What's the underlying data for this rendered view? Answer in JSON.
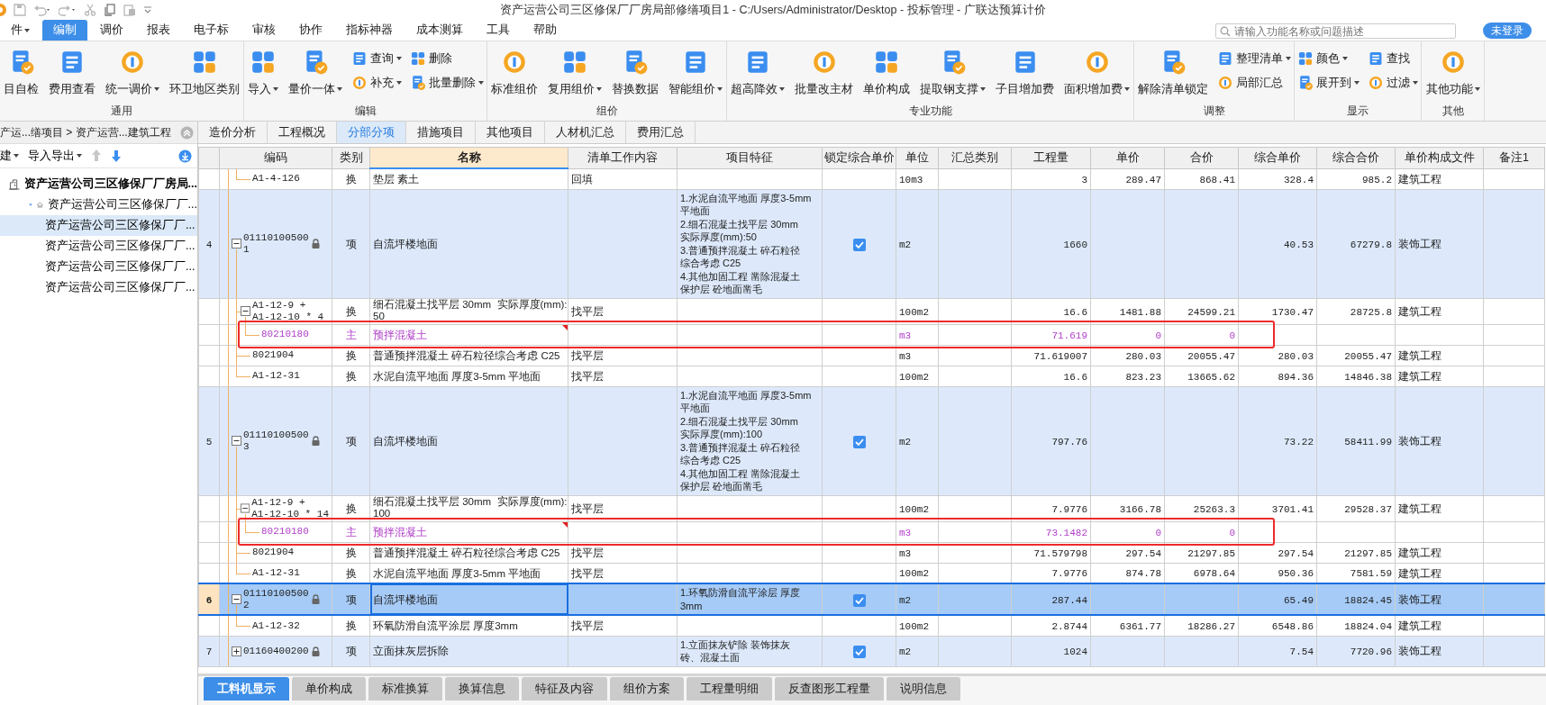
{
  "window": {
    "title": "资产运营公司三区修保厂厂房局部修缮项目1 - C:/Users/Administrator/Desktop - 投标管理 - 广联达预算计价"
  },
  "menu": [
    {
      "label": "件",
      "dropdown": true,
      "selected": false
    },
    {
      "label": "编制",
      "selected": true
    },
    {
      "label": "调价",
      "selected": false
    },
    {
      "label": "报表",
      "selected": false
    },
    {
      "label": "电子标",
      "selected": false
    },
    {
      "label": "审核",
      "selected": false
    },
    {
      "label": "协作",
      "selected": false
    },
    {
      "label": "指标神器",
      "selected": false
    },
    {
      "label": "成本测算",
      "selected": false
    },
    {
      "label": "工具",
      "selected": false
    },
    {
      "label": "帮助",
      "selected": false
    }
  ],
  "search": {
    "placeholder": "请输入功能名称或问题描述"
  },
  "login_button": "未登录",
  "ribbon": [
    {
      "label": "通用",
      "buttons": [
        {
          "kind": "large",
          "label": "目自检"
        },
        {
          "kind": "large",
          "label": "费用查看"
        },
        {
          "kind": "large",
          "label": "统一调价",
          "dropdown": true
        },
        {
          "kind": "large",
          "label": "环卫地区类别"
        }
      ]
    },
    {
      "label": "编辑",
      "buttons": [
        {
          "kind": "large",
          "label": "导入",
          "dropdown": true
        },
        {
          "kind": "large",
          "label": "量价一体",
          "dropdown": true
        },
        {
          "kind": "small",
          "label": "查询",
          "dropdown": true
        },
        {
          "kind": "small",
          "label": "补充",
          "dropdown": true
        },
        {
          "kind": "small",
          "label": "删除"
        },
        {
          "kind": "small",
          "label": "批量删除",
          "dropdown": true
        }
      ]
    },
    {
      "label": "组价",
      "buttons": [
        {
          "kind": "large",
          "label": "标准组价"
        },
        {
          "kind": "large",
          "label": "复用组价",
          "dropdown": true
        },
        {
          "kind": "large",
          "label": "替换数据"
        },
        {
          "kind": "large",
          "label": "智能组价",
          "dropdown": true
        }
      ]
    },
    {
      "label": "专业功能",
      "buttons": [
        {
          "kind": "large",
          "label": "超高降效",
          "dropdown": true
        },
        {
          "kind": "large",
          "label": "批量改主材"
        },
        {
          "kind": "large",
          "label": "单价构成"
        },
        {
          "kind": "large",
          "label": "提取钢支撑",
          "dropdown": true
        },
        {
          "kind": "large",
          "label": "子目增加费"
        },
        {
          "kind": "large",
          "label": "面积增加费",
          "dropdown": true
        }
      ]
    },
    {
      "label": "调整",
      "buttons": [
        {
          "kind": "large",
          "label": "解除清单锁定"
        },
        {
          "kind": "small",
          "label": "整理清单",
          "dropdown": true
        },
        {
          "kind": "small",
          "label": "局部汇总"
        }
      ]
    },
    {
      "label": "显示",
      "buttons": [
        {
          "kind": "small",
          "label": "颜色",
          "dropdown": true
        },
        {
          "kind": "small",
          "label": "展开到",
          "dropdown": true
        },
        {
          "kind": "small",
          "label": "查找"
        },
        {
          "kind": "small",
          "label": "过滤",
          "dropdown": true
        }
      ]
    },
    {
      "label": "其他",
      "buttons": [
        {
          "kind": "large",
          "label": "其他功能",
          "dropdown": true
        }
      ]
    }
  ],
  "sidebar": {
    "breadcrumb": "产运...缮项目 > 资产运营...建筑工程",
    "toolbar": [
      {
        "label": "建",
        "dropdown": true
      },
      {
        "label": "导入导出",
        "dropdown": true
      }
    ],
    "move_buttons": [
      {
        "disabled": true
      },
      {
        "disabled": false
      }
    ],
    "tree": {
      "label": "资产运营公司三区修保厂厂房局...",
      "selected": false,
      "children": [
        {
          "label": "资产运营公司三区修保厂厂...",
          "expanded": true,
          "selected": false,
          "children": [
            {
              "label": "资产运营公司三区修保厂厂...",
              "selected": true
            },
            {
              "label": "资产运营公司三区修保厂厂...",
              "selected": false
            },
            {
              "label": "资产运营公司三区修保厂厂...",
              "selected": false
            },
            {
              "label": "资产运营公司三区修保厂厂...",
              "selected": false
            }
          ]
        }
      ]
    }
  },
  "tabs": [
    {
      "label": "造价分析",
      "selected": false
    },
    {
      "label": "工程概况",
      "selected": false
    },
    {
      "label": "分部分项",
      "selected": true
    },
    {
      "label": "措施项目",
      "selected": false
    },
    {
      "label": "其他项目",
      "selected": false
    },
    {
      "label": "人材机汇总",
      "selected": false
    },
    {
      "label": "费用汇总",
      "selected": false
    }
  ],
  "table": {
    "columns": [
      {
        "label": "编码",
        "selected": false
      },
      {
        "label": "类别",
        "selected": false
      },
      {
        "label": "名称",
        "selected": true
      },
      {
        "label": "清单工作内容",
        "selected": false
      },
      {
        "label": "项目特征",
        "selected": false
      },
      {
        "label": "锁定综合单价",
        "selected": false
      },
      {
        "label": "单位",
        "selected": false
      },
      {
        "label": "汇总类别",
        "selected": false
      },
      {
        "label": "工程量",
        "selected": false
      },
      {
        "label": "单价",
        "selected": false
      },
      {
        "label": "合价",
        "selected": false
      },
      {
        "label": "综合单价",
        "selected": false
      },
      {
        "label": "综合合价",
        "selected": false
      },
      {
        "label": "单价构成文件",
        "selected": false
      },
      {
        "label": "备注1",
        "selected": false
      }
    ],
    "rows": [
      {
        "kind": "sub",
        "selected": false,
        "code": "A1-4-126",
        "type": "换",
        "name": "垫层 素土",
        "work": "回填",
        "unit": "10m3",
        "qty": "3",
        "price": "289.47",
        "total": "868.41",
        "comp_price": "328.4",
        "comp_total": "985.2",
        "file": "建筑工程"
      },
      {
        "kind": "item",
        "selected": false,
        "number": "4",
        "expanded": true,
        "code": "01110100500\n1",
        "type": "项",
        "name": "自流坪楼地面",
        "features": [
          "1.水泥自流平地面 厚度3-5mm",
          "平地面",
          "2.细石混凝土找平层 30mm",
          "实际厚度(mm):50",
          "3.普通预拌混凝土 碎石粒径",
          "综合考虑 C25",
          "4.其他加固工程 凿除混凝土",
          "保护层 砼地面凿毛"
        ],
        "price_locked": true,
        "unit": "m2",
        "qty": "1660",
        "comp_price": "40.53",
        "comp_total": "67279.8",
        "file": "装饰工程",
        "children": [
          {
            "kind": "sub",
            "selected": false,
            "expanded": true,
            "code": "A1-12-9 +\nA1-12-10 * 4",
            "type": "换",
            "name": "细石混凝土找平层 30mm  实际厚度(mm):\n50",
            "work": "找平层",
            "unit": "100m2",
            "qty": "16.6",
            "price": "1481.88",
            "total": "24599.21",
            "comp_price": "1730.47",
            "comp_total": "28725.8",
            "file": "建筑工程",
            "children": [
              {
                "kind": "material",
                "selected": false,
                "annotated": true,
                "note": true,
                "code": "80210180",
                "type": "主",
                "name": "预拌混凝土",
                "unit": "m3",
                "qty": "71.619",
                "price": "0",
                "total": "0"
              }
            ]
          },
          {
            "kind": "sub",
            "selected": false,
            "code": "8021904",
            "type": "换",
            "name": "普通预拌混凝土 碎石粒径综合考虑 C25",
            "work": "找平层",
            "unit": "m3",
            "qty": "71.619007",
            "price": "280.03",
            "total": "20055.47",
            "comp_price": "280.03",
            "comp_total": "20055.47",
            "file": "建筑工程"
          },
          {
            "kind": "sub",
            "selected": false,
            "code": "A1-12-31",
            "type": "换",
            "name": "水泥自流平地面 厚度3-5mm 平地面",
            "work": "找平层",
            "unit": "100m2",
            "qty": "16.6",
            "price": "823.23",
            "total": "13665.62",
            "comp_price": "894.36",
            "comp_total": "14846.38",
            "file": "建筑工程"
          }
        ]
      },
      {
        "kind": "item",
        "selected": false,
        "number": "5",
        "expanded": true,
        "code": "01110100500\n3",
        "type": "项",
        "name": "自流坪楼地面",
        "features": [
          "1.水泥自流平地面 厚度3-5mm",
          "平地面",
          "2.细石混凝土找平层 30mm",
          "实际厚度(mm):100",
          "3.普通预拌混凝土 碎石粒径",
          "综合考虑 C25",
          "4.其他加固工程 凿除混凝土",
          "保护层 砼地面凿毛"
        ],
        "price_locked": true,
        "unit": "m2",
        "qty": "797.76",
        "comp_price": "73.22",
        "comp_total": "58411.99",
        "file": "装饰工程",
        "children": [
          {
            "kind": "sub",
            "selected": false,
            "expanded": true,
            "code": "A1-12-9 +\nA1-12-10 * 14",
            "type": "换",
            "name": "细石混凝土找平层 30mm  实际厚度(mm):\n100",
            "work": "找平层",
            "unit": "100m2",
            "qty": "7.9776",
            "price": "3166.78",
            "total": "25263.3",
            "comp_price": "3701.41",
            "comp_total": "29528.37",
            "file": "建筑工程",
            "children": [
              {
                "kind": "material",
                "selected": false,
                "annotated": true,
                "note": true,
                "code": "80210180",
                "type": "主",
                "name": "预拌混凝土",
                "unit": "m3",
                "qty": "73.1482",
                "price": "0",
                "total": "0"
              }
            ]
          },
          {
            "kind": "sub",
            "selected": false,
            "code": "8021904",
            "type": "换",
            "name": "普通预拌混凝土 碎石粒径综合考虑 C25",
            "work": "找平层",
            "unit": "m3",
            "qty": "71.579798",
            "price": "297.54",
            "total": "21297.85",
            "comp_price": "297.54",
            "comp_total": "21297.85",
            "file": "建筑工程"
          },
          {
            "kind": "sub",
            "selected": false,
            "code": "A1-12-31",
            "type": "换",
            "name": "水泥自流平地面 厚度3-5mm 平地面",
            "work": "找平层",
            "unit": "100m2",
            "qty": "7.9776",
            "price": "874.78",
            "total": "6978.64",
            "comp_price": "950.36",
            "comp_total": "7581.59",
            "file": "建筑工程"
          }
        ]
      },
      {
        "kind": "item",
        "selected": true,
        "number": "6",
        "expanded": true,
        "code": "01110100500\n2",
        "type": "项",
        "name": "自流坪楼地面",
        "features": [
          "1.环氧防滑自流平涂层 厚度",
          "3mm"
        ],
        "price_locked": true,
        "unit": "m2",
        "qty": "287.44",
        "comp_price": "65.49",
        "comp_total": "18824.45",
        "file": "装饰工程",
        "children": [
          {
            "kind": "sub",
            "selected": false,
            "code": "A1-12-32",
            "type": "换",
            "name": "环氧防滑自流平涂层 厚度3mm",
            "work": "找平层",
            "unit": "100m2",
            "qty": "2.8744",
            "price": "6361.77",
            "total": "18286.27",
            "comp_price": "6548.86",
            "comp_total": "18824.04",
            "file": "建筑工程"
          }
        ]
      },
      {
        "kind": "item",
        "selected": false,
        "number": "7",
        "expanded": false,
        "code": "01160400200",
        "type": "项",
        "name": "立面抹灰层拆除",
        "features": [
          "1.立面抹灰铲除 装饰抹灰",
          "砖、混凝土面"
        ],
        "price_locked": true,
        "unit": "m2",
        "qty": "1024",
        "comp_price": "7.54",
        "comp_total": "7720.96",
        "file": "装饰工程"
      }
    ]
  },
  "bottom_tabs": [
    {
      "label": "工料机显示",
      "selected": true
    },
    {
      "label": "单价构成",
      "selected": false
    },
    {
      "label": "标准换算",
      "selected": false
    },
    {
      "label": "换算信息",
      "selected": false
    },
    {
      "label": "特征及内容",
      "selected": false
    },
    {
      "label": "组价方案",
      "selected": false
    },
    {
      "label": "工程量明细",
      "selected": false
    },
    {
      "label": "反查图形工程量",
      "selected": false
    },
    {
      "label": "说明信息",
      "selected": false
    }
  ]
}
